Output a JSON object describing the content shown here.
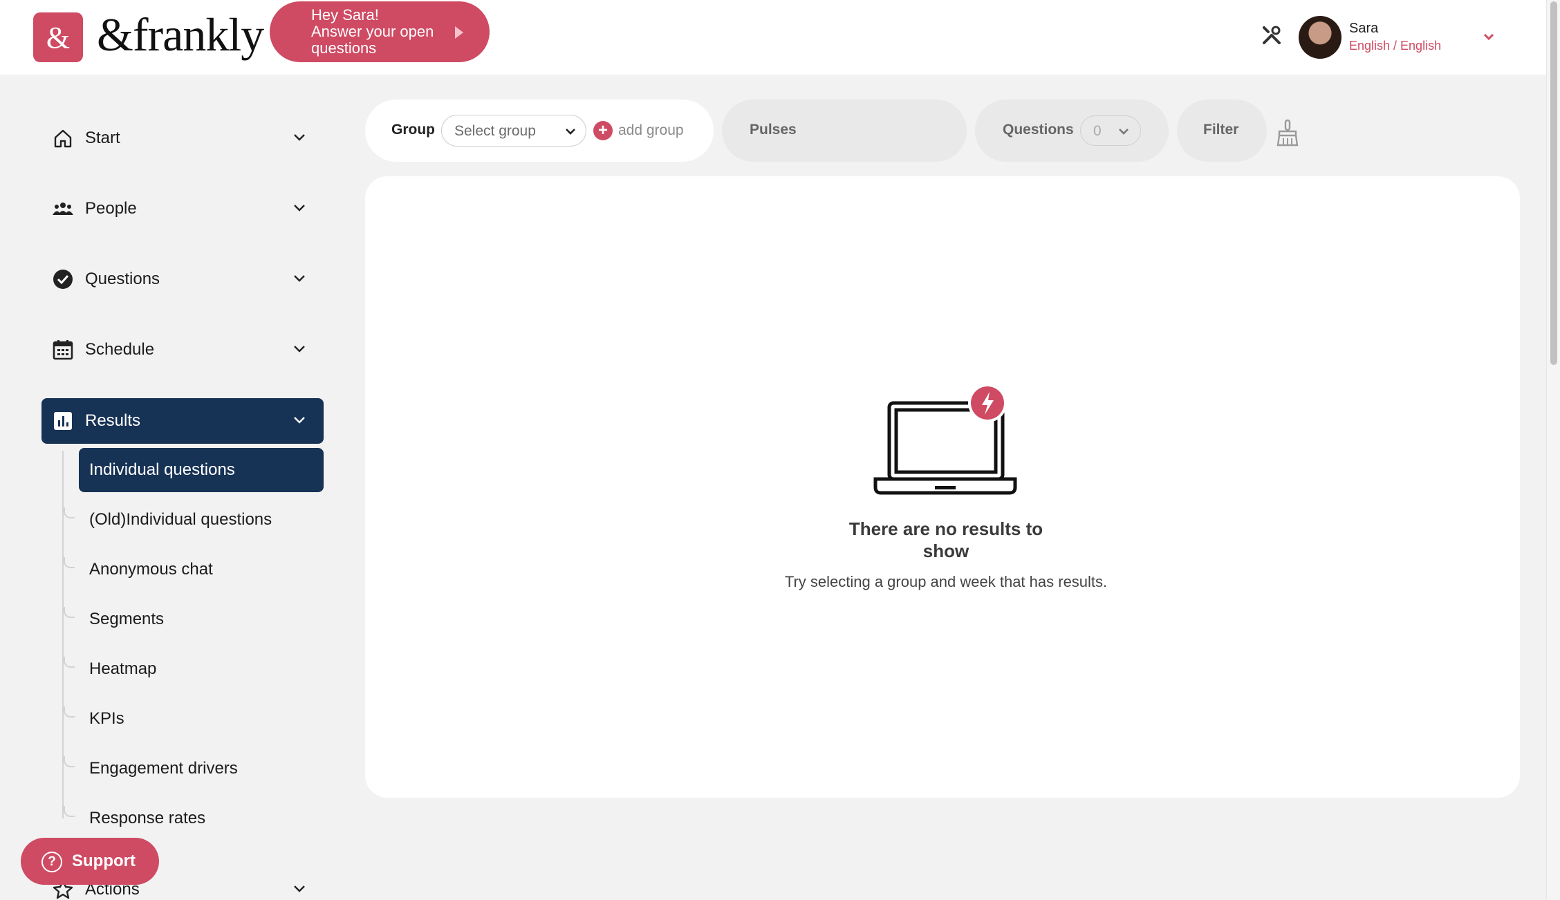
{
  "header": {
    "logo_symbol": "&",
    "logo_text": "&frankly",
    "greeting": {
      "line1": "Hey Sara!",
      "line2": "Answer your open",
      "line3": "questions"
    },
    "user": {
      "name": "Sara",
      "language": "English / English"
    },
    "icons": {
      "tools": "tools-icon",
      "chevron": "chevron-down-icon"
    }
  },
  "sidebar": {
    "items": [
      {
        "label": "Start",
        "icon": "home-icon"
      },
      {
        "label": "People",
        "icon": "people-icon"
      },
      {
        "label": "Questions",
        "icon": "check-circle-icon"
      },
      {
        "label": "Schedule",
        "icon": "calendar-icon"
      },
      {
        "label": "Results",
        "icon": "bar-chart-icon",
        "active": true
      },
      {
        "label": "Actions",
        "icon": "star-icon"
      }
    ],
    "results_subitems": [
      {
        "label": "Individual questions",
        "active": true
      },
      {
        "label": "(Old)Individual questions"
      },
      {
        "label": "Anonymous chat"
      },
      {
        "label": "Segments"
      },
      {
        "label": "Heatmap"
      },
      {
        "label": "KPIs"
      },
      {
        "label": "Engagement drivers"
      },
      {
        "label": "Response rates"
      }
    ],
    "support_label": "Support"
  },
  "filters": {
    "group_label": "Group",
    "group_placeholder": "Select group",
    "add_group_label": "add group",
    "pulses_label": "Pulses",
    "questions_label": "Questions",
    "questions_count": "0",
    "filter_label": "Filter"
  },
  "main": {
    "empty_title": "There are no results to show",
    "empty_subtitle": "Try selecting a group and week that has results."
  },
  "colors": {
    "brand": "#cf4a63",
    "nav_active": "#163255",
    "background": "#f2f2f2"
  }
}
